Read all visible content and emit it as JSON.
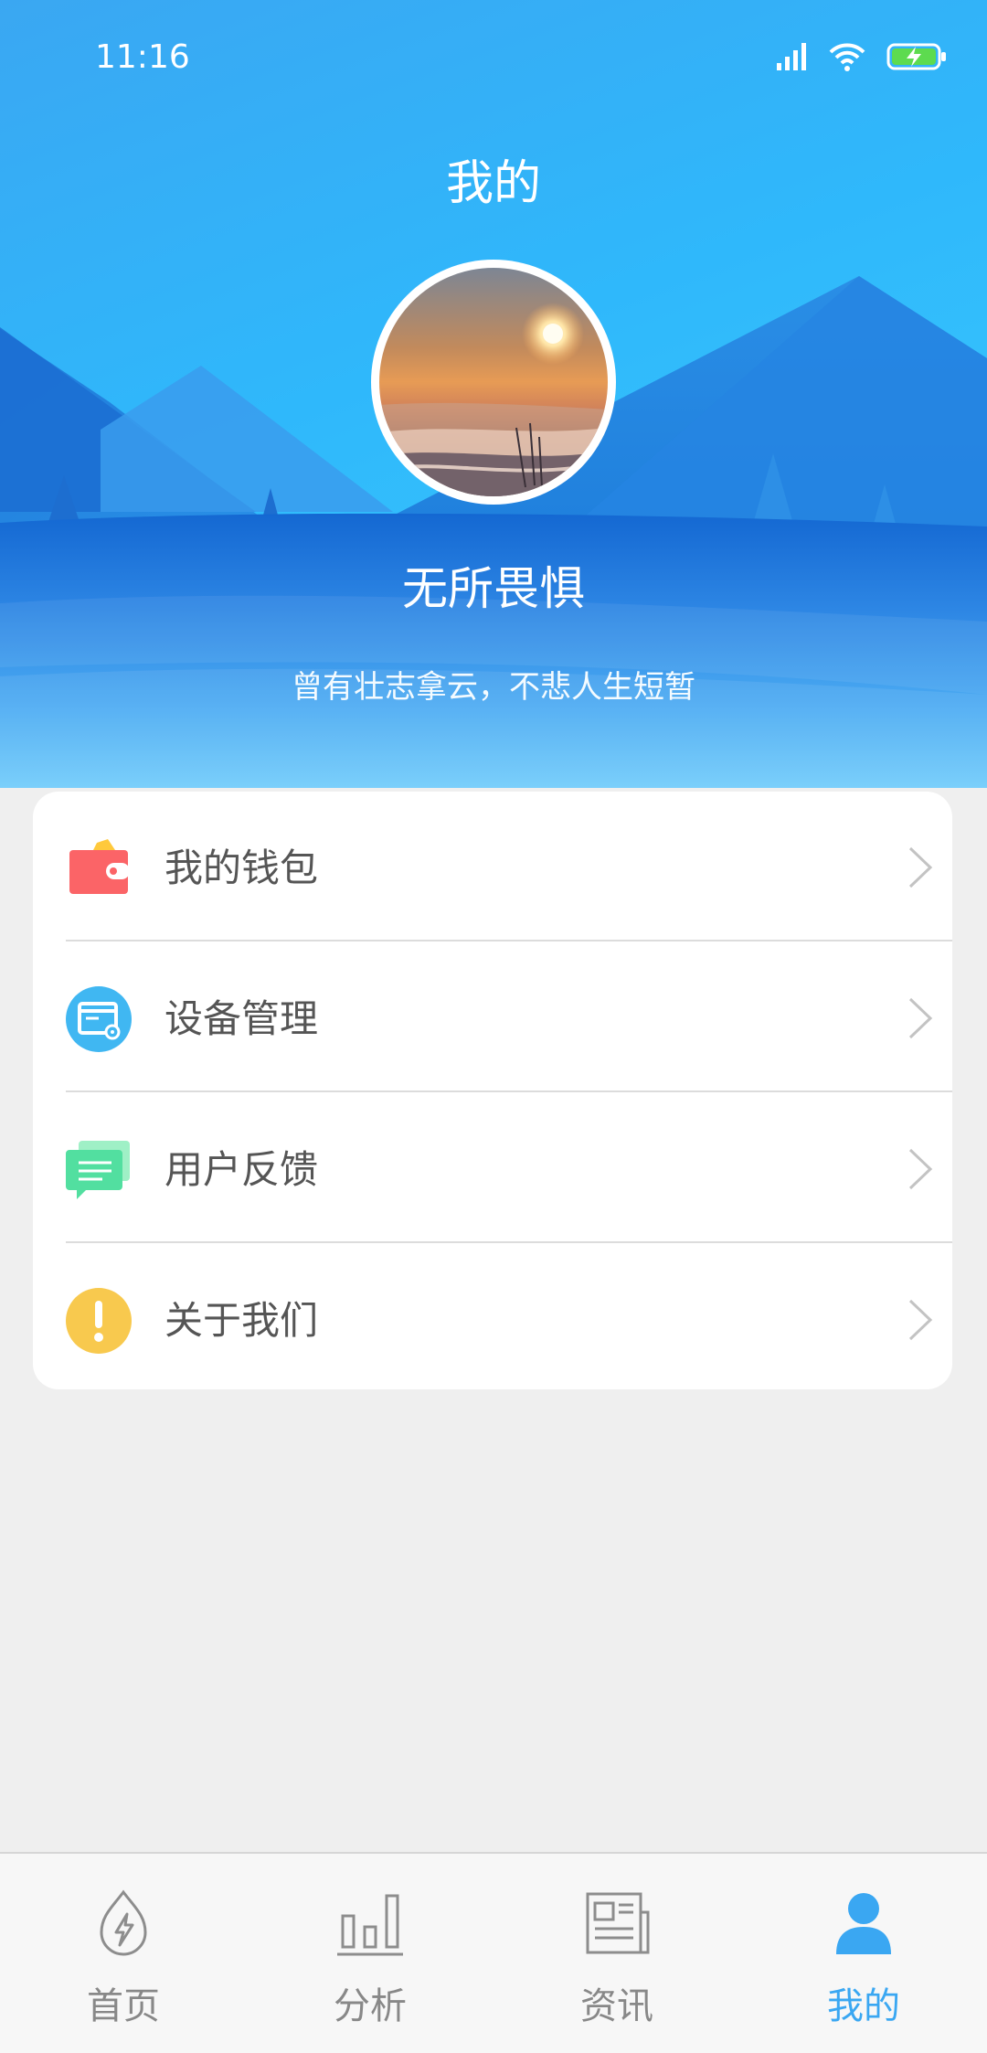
{
  "status_bar": {
    "time": "11:16",
    "icons": [
      "signal-icon",
      "wifi-icon",
      "battery-charging-icon"
    ]
  },
  "header": {
    "title": "我的",
    "avatar_icon": "avatar-sunset-photo",
    "username": "无所畏惧",
    "signature": "曾有壮志拿云，不悲人生短暂"
  },
  "menu": {
    "items": [
      {
        "label": "我的钱包",
        "icon": "wallet-icon",
        "color": "#fb6467"
      },
      {
        "label": "设备管理",
        "icon": "device-management-icon",
        "color": "#40b7f2"
      },
      {
        "label": "用户反馈",
        "icon": "feedback-icon",
        "color": "#52dfa0"
      },
      {
        "label": "关于我们",
        "icon": "about-icon",
        "color": "#f8c94e"
      }
    ]
  },
  "bottom_nav": {
    "items": [
      {
        "label": "首页",
        "icon": "home-bolt-icon",
        "active": false
      },
      {
        "label": "分析",
        "icon": "bar-chart-icon",
        "active": false
      },
      {
        "label": "资讯",
        "icon": "news-icon",
        "active": false
      },
      {
        "label": "我的",
        "icon": "user-icon",
        "active": true
      }
    ],
    "active_color": "#3aa7f2",
    "inactive_color": "#888888"
  }
}
